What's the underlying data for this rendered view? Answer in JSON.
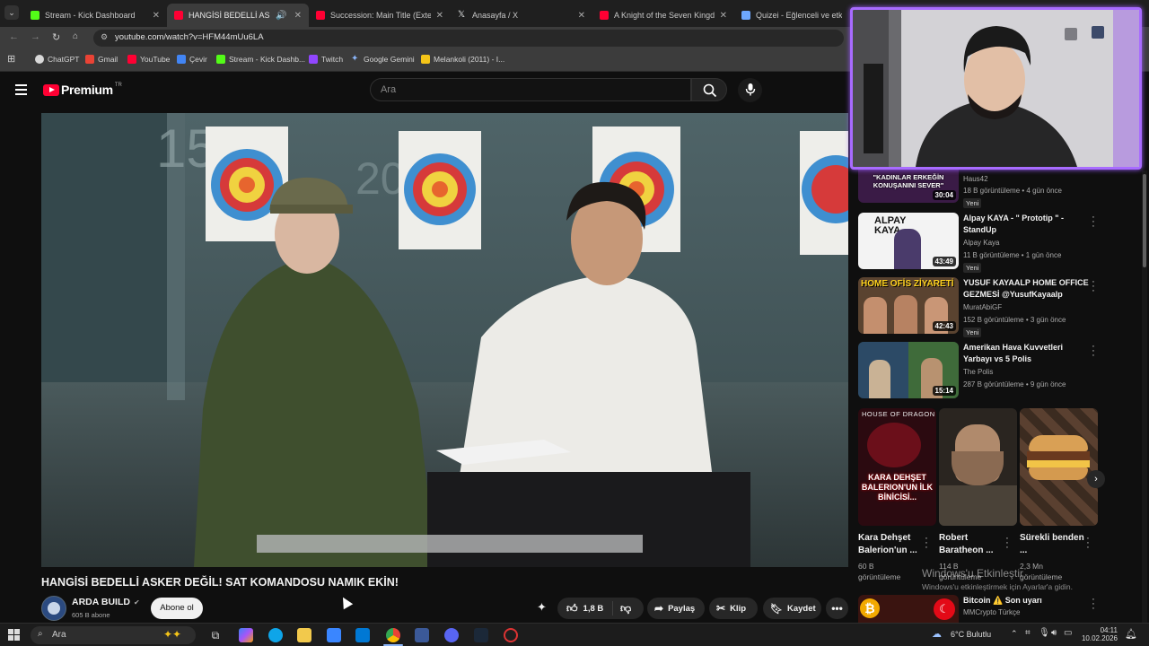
{
  "browser": {
    "tabs": [
      {
        "title": "Stream - Kick Dashboard",
        "favicon_color": "#53fc18",
        "active": false
      },
      {
        "title": "HANGİSİ BEDELLİ ASKER DE",
        "favicon_color": "#ff0033",
        "active": true
      },
      {
        "title": "Succession: Main Title (Extende",
        "favicon_color": "#ff0033",
        "active": false
      },
      {
        "title": "Anasayfa / X",
        "favicon_color": "#e7e9ea",
        "active": false
      },
      {
        "title": "A Knight of the Seven Kingdom",
        "favicon_color": "#ff0033",
        "active": false
      },
      {
        "title": "Quizei - Eğlenceli ve etkileşi",
        "favicon_color": "#6ea8fe",
        "active": false
      }
    ],
    "url": "youtube.com/watch?v=HFM44mUu6LA",
    "bookmarks": [
      {
        "label": "ChatGPT",
        "icon_color": "#d9d9d9"
      },
      {
        "label": "Gmail",
        "icon_color": "#ea4335"
      },
      {
        "label": "YouTube",
        "icon_color": "#ff0033"
      },
      {
        "label": "Çevir",
        "icon_color": "#4285f4"
      },
      {
        "label": "Stream - Kick Dashb...",
        "icon_color": "#53fc18"
      },
      {
        "label": "Twitch",
        "icon_color": "#9146ff"
      },
      {
        "label": "Google Gemini",
        "icon_color": "#8ab4f8"
      },
      {
        "label": "Melankoli (2011) - I...",
        "icon_color": "#f5c518"
      }
    ]
  },
  "youtube": {
    "logo_text": "Premium",
    "logo_sup": "TR",
    "search_placeholder": "Ara",
    "video": {
      "title": "HANGİSİ BEDELLİ ASKER DEĞİL! SAT KOMANDOSU NAMIK EKİN!",
      "channel": "ARDA BUILD",
      "subscribers": "605 B abone",
      "subscribe_label": "Abone ol",
      "likes": "1,8 B",
      "share_label": "Paylaş",
      "clip_label": "Klip",
      "save_label": "Kaydet"
    },
    "sidebar_videos": [
      {
        "thumb_text": "\"KADINLAR ERKEĞİN KONUŞANINI SEVER\"",
        "duration": "30:04",
        "title": "",
        "channel": "Haus42",
        "meta": "18 B görüntüleme • 4 gün önce",
        "badge": "Yeni"
      },
      {
        "thumb_text": "ALPAY KAYA",
        "duration": "43:49",
        "title": "Alpay KAYA - \" Prototip \" - StandUp",
        "channel": "Alpay Kaya",
        "meta": "11 B görüntüleme • 1 gün önce",
        "badge": "Yeni"
      },
      {
        "thumb_text": "HOME OFİS ZİYARETİ",
        "duration": "42:43",
        "title": "YUSUF KAYAALP HOME OFFICE GEZMESİ @YusufKayaalp",
        "channel": "MuratAbiGF",
        "meta": "152 B görüntüleme • 3 gün önce",
        "badge": "Yeni"
      },
      {
        "thumb_text": "",
        "duration": "15:14",
        "title": "Amerikan Hava Kuvvetleri Yarbayı vs 5 Polis",
        "channel": "The Polis",
        "meta": "287 B görüntüleme • 9 gün önce",
        "badge": ""
      }
    ],
    "shorts": [
      {
        "thumb_top": "HOUSE OF DRAGON",
        "thumb_text": "KARA DEHŞET BALERION'UN İLK BİNİCİSİ...",
        "title": "Kara Dehşet Balerion'un ...",
        "views_line1": "60 B",
        "views_line2": "görüntüleme"
      },
      {
        "thumb_top": "",
        "thumb_text": "",
        "title": "Robert Baratheon ...",
        "views_line1": "114 B",
        "views_line2": "görüntüleme"
      },
      {
        "thumb_top": "",
        "thumb_text": "",
        "title": "Sürekli benden ...",
        "views_line1": "2,3 Mn",
        "views_line2": "görüntüleme"
      }
    ],
    "last_item": {
      "title": "Bitcoin ⚠️ Son uyarı",
      "channel": "MMCrypto Türkçe"
    },
    "watermark_line1": "Windows'u Etkinleştir",
    "watermark_line2": "Windows'u etkinleştirmek için Ayarlar'a gidin."
  },
  "taskbar": {
    "search_placeholder": "Ara",
    "weather": "6°C Bulutlu",
    "time": "04:11",
    "date": "10.02.2026"
  },
  "colors": {
    "yt_red": "#ff0033",
    "webcam_border": "#a86bff",
    "kick_green": "#53fc18"
  }
}
